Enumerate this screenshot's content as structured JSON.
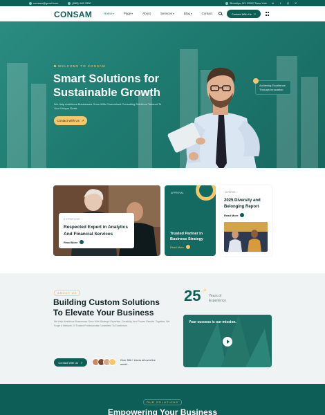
{
  "topbar": {
    "email": "consam@gmail.com",
    "phone": "(888) 446-7890",
    "address": "Brooklyn, NY 12207 New York",
    "social": [
      "in",
      "f",
      "ig",
      "x"
    ]
  },
  "header": {
    "logo": "CONSAM",
    "nav": [
      {
        "label": "Home",
        "caret": true
      },
      {
        "label": "Page",
        "caret": true
      },
      {
        "label": "About",
        "caret": false
      },
      {
        "label": "Services",
        "caret": true
      },
      {
        "label": "Blog",
        "caret": true
      },
      {
        "label": "Contact",
        "caret": false
      }
    ],
    "contact_button": "Contact With Us"
  },
  "hero": {
    "welcome": "WELCOME TO CONSAM",
    "title": "Smart Solutions for Sustainable Growth",
    "description": "We Help Ambitious Businesses Grow With Customized Consulting Solutions Tailored To Your Unique Goals.",
    "button": "Contact With Us",
    "badge": "Achieving Excellence Through Innovation"
  },
  "cards": {
    "card1": {
      "tag": "EXPERTISE",
      "title": "Respected Expert in Analytics And Financial Services",
      "readmore": "Read More"
    },
    "card2": {
      "tag": "APPROVAL",
      "title": "Trusted Partner in Business Strategy",
      "readmore": "Read More"
    },
    "card3": {
      "tag": "DIVERSE",
      "title": "2025 Diversity and Belonging Report",
      "readmore": "Read More"
    }
  },
  "about": {
    "tag": "ABOUT US",
    "title": "Building Custom Solutions To Elevate Your Business",
    "description": "We Help Ambitious Businesses Grow With Strategic Expertise, Creativity, And Proven Results. Together, We Forge A Network Of Trusted Professionals Committed To Excellence.",
    "button": "Contact With Us",
    "users_text": "Over 50k+ Users all over the world...",
    "stat_number": "25",
    "stat_plus": "+",
    "stat_label": "Years of Experience",
    "mission": "Your success is our mission."
  },
  "solutions": {
    "tag": "OUR SOLUTIONS",
    "title": "Empowering Your Business"
  },
  "colors": {
    "primary": "#0d5e56",
    "accent": "#f6c76a",
    "hero_bg": "#1f7c71"
  }
}
